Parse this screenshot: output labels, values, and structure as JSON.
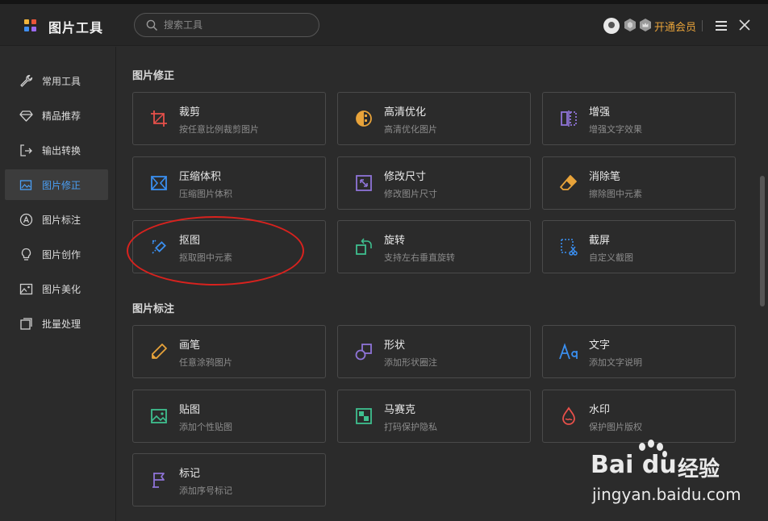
{
  "header": {
    "title": "图片工具",
    "search_placeholder": "搜索工具",
    "vip_label": "开通会员"
  },
  "colors": {
    "accent": "#4a9ff5",
    "vip": "#e8a33a",
    "annotation": "#d8221e"
  },
  "sidebar": {
    "items": [
      {
        "label": "常用工具",
        "icon": "wrench-icon"
      },
      {
        "label": "精品推荐",
        "icon": "diamond-icon"
      },
      {
        "label": "输出转换",
        "icon": "convert-icon"
      },
      {
        "label": "图片修正",
        "icon": "image-edit-icon",
        "active": true
      },
      {
        "label": "图片标注",
        "icon": "annotate-icon"
      },
      {
        "label": "图片创作",
        "icon": "bulb-icon"
      },
      {
        "label": "图片美化",
        "icon": "image-icon"
      },
      {
        "label": "批量处理",
        "icon": "batch-icon"
      }
    ]
  },
  "sections": [
    {
      "title": "图片修正",
      "tools": [
        {
          "name": "裁剪",
          "desc": "按任意比例裁剪图片",
          "icon": "crop-icon"
        },
        {
          "name": "高清优化",
          "desc": "高清优化图片",
          "icon": "hd-enhance-icon"
        },
        {
          "name": "增强",
          "desc": "增强文字效果",
          "icon": "enhance-icon"
        },
        {
          "name": "压缩体积",
          "desc": "压缩图片体积",
          "icon": "compress-icon"
        },
        {
          "name": "修改尺寸",
          "desc": "修改图片尺寸",
          "icon": "resize-icon"
        },
        {
          "name": "消除笔",
          "desc": "擦除图中元素",
          "icon": "eraser-icon"
        },
        {
          "name": "抠图",
          "desc": "抠取图中元素",
          "icon": "cutout-icon"
        },
        {
          "name": "旋转",
          "desc": "支持左右垂直旋转",
          "icon": "rotate-icon"
        },
        {
          "name": "截屏",
          "desc": "自定义截图",
          "icon": "screenshot-icon"
        }
      ]
    },
    {
      "title": "图片标注",
      "tools": [
        {
          "name": "画笔",
          "desc": "任意涂鸦图片",
          "icon": "pen-icon"
        },
        {
          "name": "形状",
          "desc": "添加形状圈注",
          "icon": "shape-icon"
        },
        {
          "name": "文字",
          "desc": "添加文字说明",
          "icon": "text-icon"
        },
        {
          "name": "贴图",
          "desc": "添加个性贴图",
          "icon": "sticker-icon"
        },
        {
          "name": "马赛克",
          "desc": "打码保护隐私",
          "icon": "mosaic-icon"
        },
        {
          "name": "水印",
          "desc": "保护图片版权",
          "icon": "watermark-icon"
        },
        {
          "name": "标记",
          "desc": "添加序号标记",
          "icon": "flag-icon"
        }
      ]
    }
  ],
  "watermark": {
    "brand": "Bai du",
    "jingyan": "经验",
    "url": "jingyan.baidu.com"
  }
}
